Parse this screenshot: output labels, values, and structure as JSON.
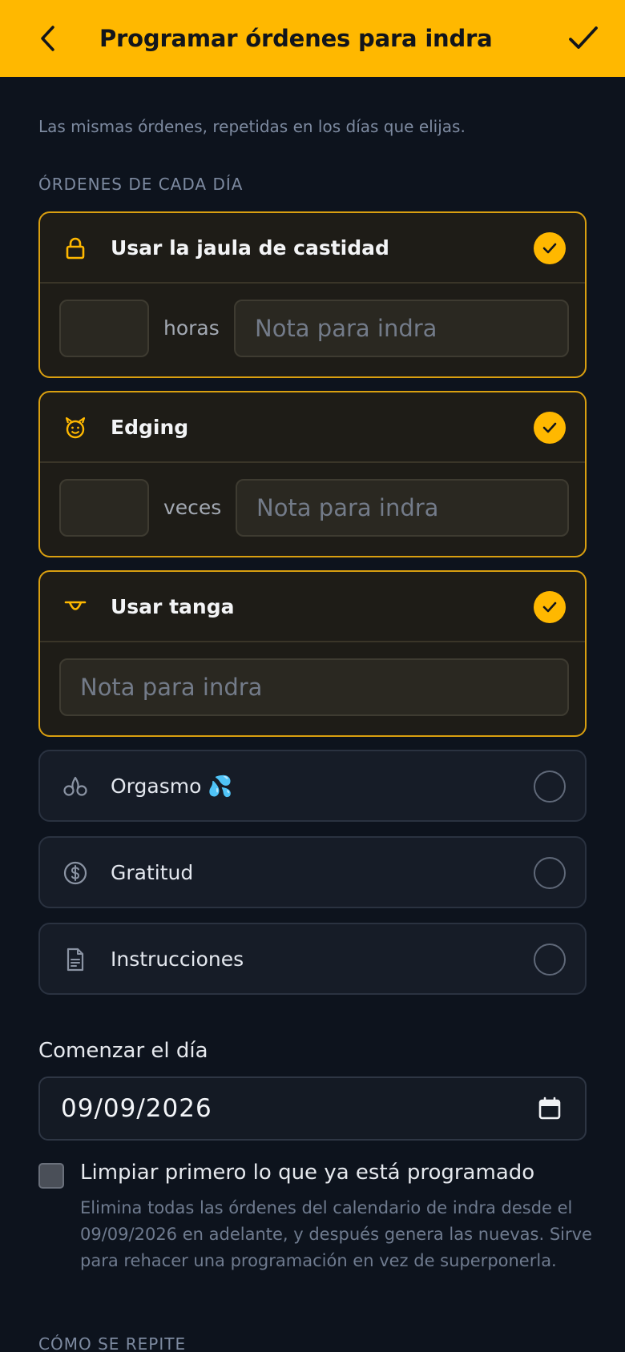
{
  "header": {
    "title": "Programar órdenes para indra",
    "back_icon": "arrow-left-icon",
    "confirm_icon": "check-icon"
  },
  "subtitle": "Las mismas órdenes, repetidas en los días que elijas.",
  "orders_section_label": "ÓRDENES DE CADA DÍA",
  "orders": [
    {
      "label": "Usar la jaula de castidad",
      "icon": "lock-icon",
      "selected": true,
      "unit": "horas",
      "note_placeholder": "Nota para indra"
    },
    {
      "label": "Edging",
      "icon": "devil-face-icon",
      "selected": true,
      "unit": "veces",
      "note_placeholder": "Nota para indra"
    },
    {
      "label": "Usar tanga",
      "icon": "thong-icon",
      "selected": true,
      "note_placeholder": "Nota para indra"
    },
    {
      "label": "Orgasmo 💦",
      "icon": "orgasm-icon",
      "selected": false
    },
    {
      "label": "Gratitud",
      "icon": "dollar-coin-icon",
      "selected": false
    },
    {
      "label": "Instrucciones",
      "icon": "document-icon",
      "selected": false
    }
  ],
  "start": {
    "label": "Comenzar el día",
    "date": "09/09/2026",
    "calendar_icon": "calendar-icon"
  },
  "clear_option": {
    "checked": false,
    "label": "Limpiar primero lo que ya está programado",
    "help": "Elimina todas las órdenes del calendario de indra desde el 09/09/2026 en adelante, y después genera las nuevas. Sirve para rehacer una programación en vez de superponerla."
  },
  "repeat_section_label": "CÓMO SE REPITE",
  "colors": {
    "accent": "#ffb800",
    "background": "#0d131d",
    "card_selected_border": "#d99f10"
  }
}
